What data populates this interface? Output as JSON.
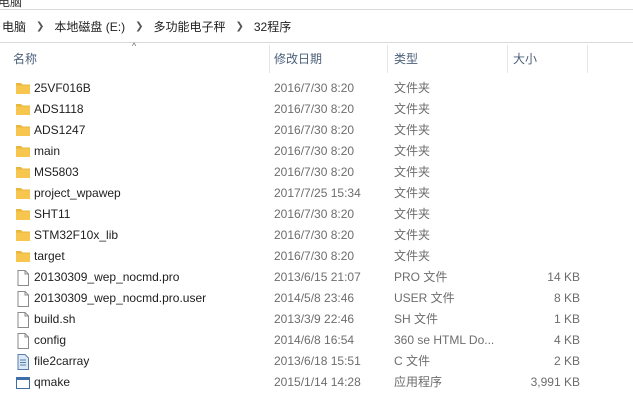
{
  "partial_top_text": "电脑",
  "breadcrumb": [
    "电脑",
    "本地磁盘 (E:)",
    "多功能电子秤",
    "32程序"
  ],
  "columns": {
    "name": "名称",
    "date": "修改日期",
    "type": "类型",
    "size": "大小"
  },
  "colors": {
    "folder": "#f6c64f",
    "header_text": "#4c607a",
    "meta_text": "#6d6d6d"
  },
  "files": [
    {
      "icon": "folder-icon",
      "name": "25VF016B",
      "date": "2016/7/30 8:20",
      "type": "文件夹",
      "size": ""
    },
    {
      "icon": "folder-icon",
      "name": "ADS1118",
      "date": "2016/7/30 8:20",
      "type": "文件夹",
      "size": ""
    },
    {
      "icon": "folder-icon",
      "name": "ADS1247",
      "date": "2016/7/30 8:20",
      "type": "文件夹",
      "size": ""
    },
    {
      "icon": "folder-icon",
      "name": "main",
      "date": "2016/7/30 8:20",
      "type": "文件夹",
      "size": ""
    },
    {
      "icon": "folder-icon",
      "name": "MS5803",
      "date": "2016/7/30 8:20",
      "type": "文件夹",
      "size": ""
    },
    {
      "icon": "folder-icon",
      "name": "project_wpawep",
      "date": "2017/7/25 15:34",
      "type": "文件夹",
      "size": ""
    },
    {
      "icon": "folder-icon",
      "name": "SHT11",
      "date": "2016/7/30 8:20",
      "type": "文件夹",
      "size": ""
    },
    {
      "icon": "folder-icon",
      "name": "STM32F10x_lib",
      "date": "2016/7/30 8:20",
      "type": "文件夹",
      "size": ""
    },
    {
      "icon": "folder-icon",
      "name": "target",
      "date": "2016/7/30 8:20",
      "type": "文件夹",
      "size": ""
    },
    {
      "icon": "file-icon",
      "name": "20130309_wep_nocmd.pro",
      "date": "2013/6/15 21:07",
      "type": "PRO 文件",
      "size": "14 KB"
    },
    {
      "icon": "file-icon",
      "name": "20130309_wep_nocmd.pro.user",
      "date": "2014/5/8 23:46",
      "type": "USER 文件",
      "size": "8 KB"
    },
    {
      "icon": "file-icon",
      "name": "build.sh",
      "date": "2013/3/9 22:46",
      "type": "SH 文件",
      "size": "1 KB"
    },
    {
      "icon": "file-icon",
      "name": "config",
      "date": "2014/6/8 16:54",
      "type": "360 se HTML Do...",
      "size": "4 KB"
    },
    {
      "icon": "batch-file-icon",
      "name": "file2carray",
      "date": "2013/6/18 15:51",
      "type": "C 文件",
      "size": "2 KB"
    },
    {
      "icon": "application-icon",
      "name": "qmake",
      "date": "2015/1/14 14:28",
      "type": "应用程序",
      "size": "3,991 KB"
    }
  ]
}
